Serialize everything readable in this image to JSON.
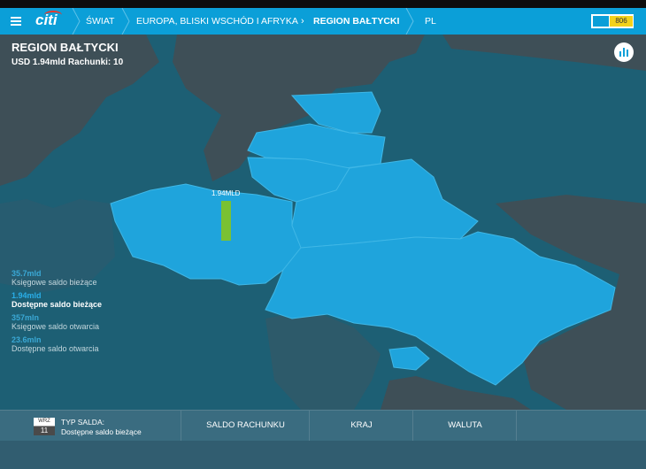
{
  "header": {
    "breadcrumbs": [
      "ŚWIAT",
      "EUROPA, BLISKI WSCHÓD I AFRYKA",
      "REGION BAŁTYCKI",
      "PL"
    ],
    "badge": "806",
    "logo_text": "citi"
  },
  "region": {
    "title": "REGION BAŁTYCKI",
    "summary": "USD 1.94mld   Rachunki: 10"
  },
  "map": {
    "bar_label": "1.94MLD",
    "colors": {
      "country_fill": "#1fa4dc",
      "sea": "#1d5f74",
      "land_other": "#3e4f57",
      "bar": "#7ac133"
    }
  },
  "legend": [
    {
      "value": "35.7mld",
      "label": "Księgowe saldo bieżące",
      "active": false
    },
    {
      "value": "1.94mld",
      "label": "Dostępne saldo bieżące",
      "active": true
    },
    {
      "value": "357mln",
      "label": "Księgowe saldo otwarcia",
      "active": false
    },
    {
      "value": "23.6mln",
      "label": "Dostępne saldo otwarcia",
      "active": false
    }
  ],
  "footer": {
    "calendar_month": "WRZ",
    "calendar_day": "11",
    "type_label": "TYP SALDA:",
    "type_value": "Dostępne saldo bieżące",
    "tabs": [
      "SALDO RACHUNKU",
      "KRAJ",
      "WALUTA"
    ]
  }
}
